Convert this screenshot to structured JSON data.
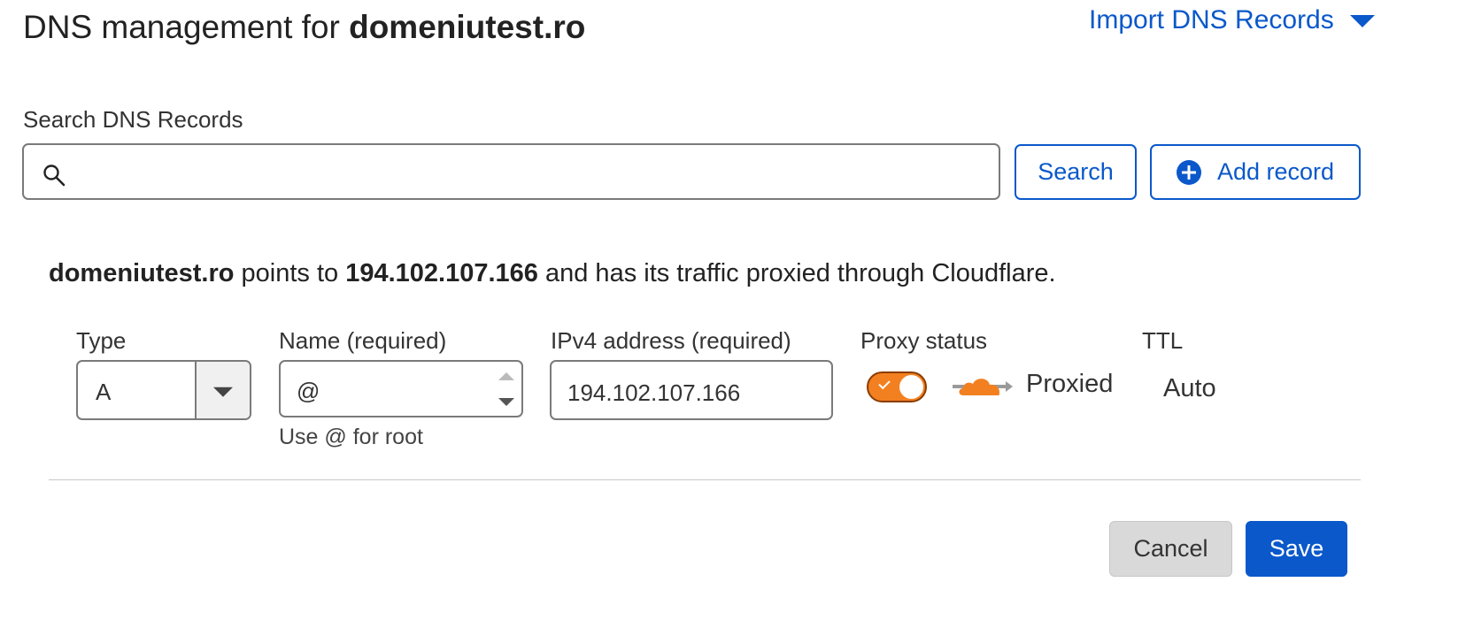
{
  "header": {
    "title_prefix": "DNS management for ",
    "domain": "domeniutest.ro",
    "import_label": "Import DNS Records"
  },
  "search": {
    "label": "Search DNS Records",
    "value": "",
    "placeholder": "",
    "search_button": "Search",
    "add_record_button": "Add record"
  },
  "info": {
    "domain": "domeniutest.ro",
    "points_to": " points to ",
    "ip": "194.102.107.166",
    "suffix": " and has its traffic proxied through Cloudflare."
  },
  "form": {
    "type_label": "Type",
    "type_value": "A",
    "name_label": "Name (required)",
    "name_value": "@",
    "name_help": "Use @ for root",
    "ipv4_label": "IPv4 address (required)",
    "ipv4_value": "194.102.107.166",
    "proxy_label": "Proxy status",
    "proxy_enabled": true,
    "proxy_value": "Proxied",
    "ttl_label": "TTL",
    "ttl_value": "Auto"
  },
  "actions": {
    "cancel": "Cancel",
    "save": "Save"
  },
  "colors": {
    "accent": "#0a58ca",
    "cloudflare_orange": "#f38020"
  },
  "icons": {
    "search": "magnifier",
    "add": "plus-circle",
    "dropdown": "caret-down",
    "proxy": "cloud-arrow"
  }
}
